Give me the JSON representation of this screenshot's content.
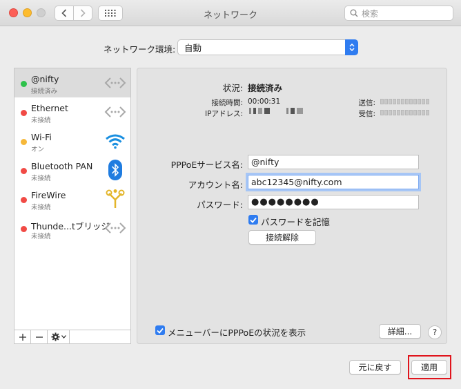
{
  "window": {
    "title": "ネットワーク",
    "search_placeholder": "検索"
  },
  "location": {
    "label": "ネットワーク環境:",
    "value": "自動"
  },
  "services": [
    {
      "name": "@nifty",
      "status": "接続済み",
      "state": "connected",
      "icon": "ppp-icon"
    },
    {
      "name": "Ethernet",
      "status": "未接続",
      "state": "disconnected",
      "icon": "ethernet-icon"
    },
    {
      "name": "Wi-Fi",
      "status": "オン",
      "state": "on",
      "icon": "wifi-icon"
    },
    {
      "name": "Bluetooth PAN",
      "status": "未接続",
      "state": "disconnected",
      "icon": "bluetooth-icon"
    },
    {
      "name": "FireWire",
      "status": "未接続",
      "state": "disconnected",
      "icon": "firewire-icon"
    },
    {
      "name": "Thunde...tブリッジ",
      "status": "未接続",
      "state": "disconnected",
      "icon": "thunderbolt-bridge-icon"
    }
  ],
  "detail": {
    "status_label": "状況:",
    "status_value": "接続済み",
    "connect_time_label": "接続時間:",
    "connect_time_value": "00:00:31",
    "ip_label": "IPアドレス:",
    "sent_label": "送信:",
    "received_label": "受信:",
    "service_name_label": "PPPoEサービス名:",
    "service_name_value": "@nifty",
    "account_label": "アカウント名:",
    "account_value": "abc12345@nifty.com",
    "password_label": "パスワード:",
    "password_value": "●●●●●●●●",
    "remember_password_label": "パスワードを記憶",
    "remember_password_checked": true,
    "disconnect_button": "接続解除",
    "show_status_label": "メニューバーにPPPoEの状況を表示",
    "show_status_checked": true,
    "advanced_button": "詳細...",
    "help_button": "?"
  },
  "footer": {
    "revert_button": "元に戻す",
    "apply_button": "適用"
  },
  "colors": {
    "accent": "#2f7cf0",
    "connected": "#2ec24b",
    "on": "#f6b83a",
    "disconnected": "#f14a45",
    "highlight_box": "#e0141c"
  }
}
